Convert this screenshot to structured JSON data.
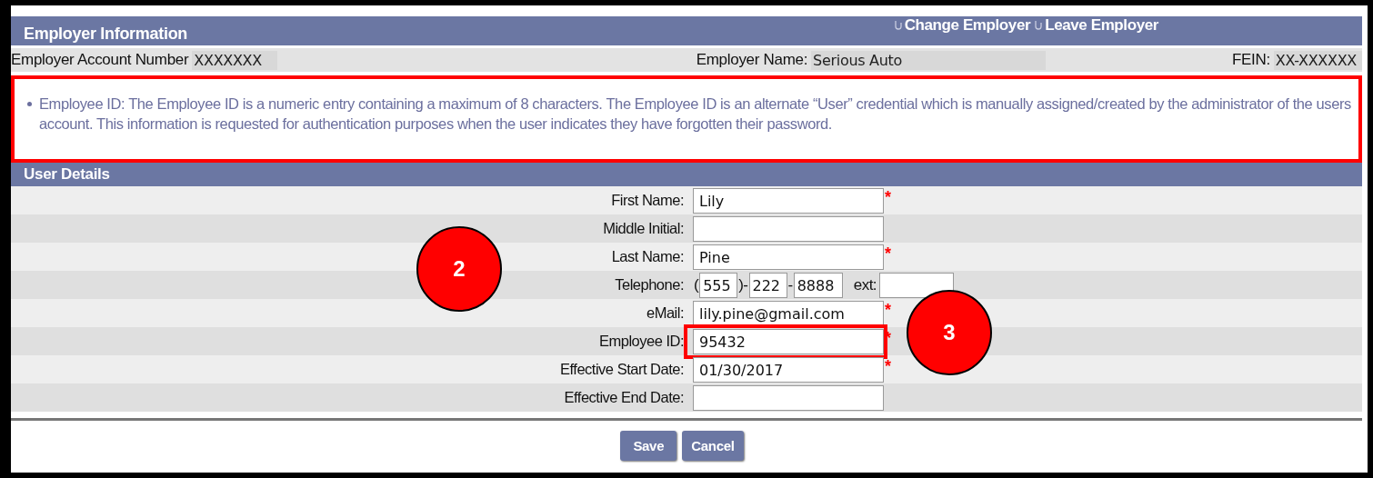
{
  "header": {
    "title": "Employer Information",
    "links": [
      {
        "label": "Change Employer"
      },
      {
        "label": "Leave Employer"
      }
    ]
  },
  "employer": [
    {
      "label": "Employer Account Number",
      "value": "XXXXXXX"
    },
    {
      "label": "Employer Name:",
      "value": "Serious Auto"
    },
    {
      "label": "FEIN:",
      "value": "XX-XXXXXX"
    }
  ],
  "notice": {
    "text": "Employee ID: The Employee ID is a numeric entry containing a maximum of 8 characters. The Employee ID is an alternate “User” credential which is manually assigned/created by the administrator of the users account. This information is requested for authentication purposes when the user indicates they have forgotten their password.",
    "highlighted": true
  },
  "user_details": {
    "title": "User Details",
    "fields": [
      {
        "kind": "text",
        "label": "First Name:",
        "value": "Lily",
        "required_mark": "*",
        "highlighted": false
      },
      {
        "kind": "text",
        "label": "Middle Initial:",
        "highlighted": false
      },
      {
        "kind": "text",
        "label": "Last Name:",
        "value": "Pine",
        "required_mark": "*",
        "highlighted": false
      },
      {
        "kind": "phone",
        "label": "Telephone:",
        "segments": [
          {
            "kind": "sep",
            "text": "("
          },
          {
            "kind": "input",
            "value": "555"
          },
          {
            "kind": "sep",
            "text": ")-"
          },
          {
            "kind": "input",
            "value": "222"
          },
          {
            "kind": "sep",
            "text": "-"
          },
          {
            "kind": "input",
            "value": "8888"
          },
          {
            "kind": "sep",
            "text": "ext:"
          },
          {
            "kind": "input"
          }
        ]
      },
      {
        "kind": "text",
        "label": "eMail:",
        "value": "lily.pine@gmail.com",
        "required_mark": "*",
        "highlighted": false
      },
      {
        "kind": "text",
        "label": "Employee ID:",
        "value": "95432",
        "required_mark": "*",
        "highlighted": true
      },
      {
        "kind": "text",
        "label": "Effective Start Date:",
        "value": "01/30/2017",
        "required_mark": "*",
        "highlighted": false
      },
      {
        "kind": "text",
        "label": "Effective End Date:",
        "highlighted": false
      }
    ]
  },
  "buttons": [
    {
      "label": "Save"
    },
    {
      "label": "Cancel"
    }
  ],
  "callouts": [
    {
      "label": "2"
    },
    {
      "label": "3"
    }
  ]
}
